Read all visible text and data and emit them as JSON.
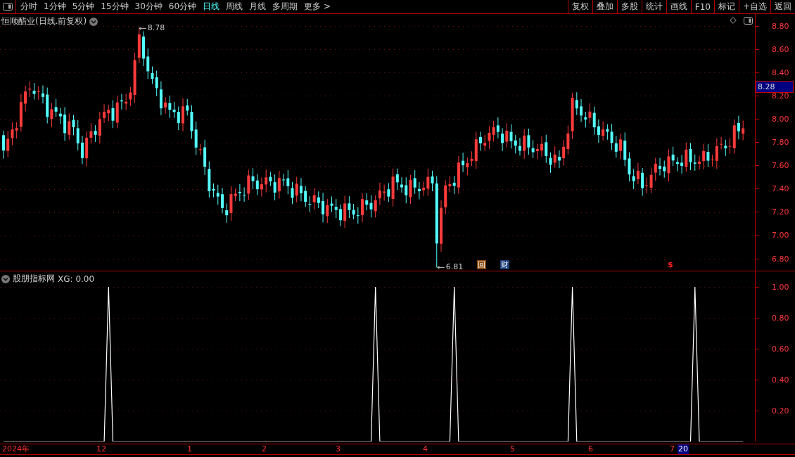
{
  "toolbar": {
    "periods": [
      {
        "label": "分时",
        "selected": false
      },
      {
        "label": "1分钟",
        "selected": false
      },
      {
        "label": "5分钟",
        "selected": false
      },
      {
        "label": "15分钟",
        "selected": false
      },
      {
        "label": "30分钟",
        "selected": false
      },
      {
        "label": "60分钟",
        "selected": false
      },
      {
        "label": "日线",
        "selected": true
      },
      {
        "label": "周线",
        "selected": false
      },
      {
        "label": "月线",
        "selected": false
      },
      {
        "label": "多周期",
        "selected": false
      },
      {
        "label": "更多 >",
        "selected": false
      }
    ],
    "actions": [
      "复权",
      "叠加",
      "多股",
      "统计",
      "画线",
      "F10",
      "标记",
      "+自选",
      "返回"
    ]
  },
  "price_panel": {
    "title": "恒顺醋业(日线.前复权)",
    "high_label": "8.78",
    "low_label": "6.81",
    "markers": [
      {
        "text": "回",
        "kind": "box"
      },
      {
        "text": "财",
        "kind": "finance"
      },
      {
        "text": "$",
        "kind": "dividend"
      }
    ],
    "axis_labels": [
      "8.80",
      "8.60",
      "8.40",
      "8.20",
      "8.00",
      "7.80",
      "7.60",
      "7.40",
      "7.20",
      "7.00",
      "6.80"
    ],
    "current_price": "8.28"
  },
  "indicator_panel": {
    "title": "股朋指标网",
    "value_label": ": 0.00",
    "chart_data": {
      "type": "line",
      "grid": true,
      "ylim": [
        0,
        1.0
      ],
      "yticks": [
        {
          "value": 0.2,
          "label": "0.20"
        },
        {
          "value": 0.4,
          "label": "0.40"
        },
        {
          "value": 0.6,
          "label": "0.60"
        },
        {
          "value": 0.8,
          "label": "0.80"
        },
        {
          "value": 1.0,
          "label": "1.00"
        }
      ],
      "series": [
        {
          "name": "XG",
          "color": "#ffffff",
          "values": [
            0,
            0,
            0,
            0,
            0,
            0,
            0,
            0,
            0,
            0,
            0,
            0,
            0,
            0,
            0,
            0,
            0,
            0,
            0,
            0,
            0,
            0,
            0,
            0,
            1,
            0,
            0,
            0,
            0,
            0,
            0,
            0,
            0,
            0,
            0,
            0,
            0,
            0,
            0,
            0,
            0,
            0,
            0,
            0,
            0,
            0,
            0,
            0,
            0,
            0,
            0,
            0,
            0,
            0,
            0,
            0,
            0,
            0,
            0,
            0,
            0,
            0,
            0,
            0,
            0,
            0,
            0,
            0,
            0,
            0,
            0,
            0,
            0,
            0,
            0,
            0,
            0,
            0,
            0,
            0,
            0,
            0,
            0,
            0,
            0,
            1,
            0,
            0,
            0,
            0,
            0,
            0,
            0,
            0,
            0,
            0,
            0,
            0,
            0,
            0,
            0,
            0,
            0,
            1,
            0,
            0,
            0,
            0,
            0,
            0,
            0,
            0,
            0,
            0,
            0,
            0,
            0,
            0,
            0,
            0,
            0,
            0,
            0,
            0,
            0,
            0,
            0,
            0,
            0,
            0,
            1,
            0,
            0,
            0,
            0,
            0,
            0,
            0,
            0,
            0,
            0,
            0,
            0,
            0,
            0,
            0,
            0,
            0,
            0,
            0,
            0,
            0,
            0,
            0,
            0,
            0,
            0,
            0,
            1,
            0,
            0,
            0,
            0,
            0,
            0,
            0,
            0,
            0,
            0,
            0
          ]
        }
      ]
    }
  },
  "date_axis": [
    {
      "label": "2024年",
      "highlighted": false
    },
    {
      "label": "12",
      "highlighted": false
    },
    {
      "label": "1",
      "highlighted": false
    },
    {
      "label": "2",
      "highlighted": false
    },
    {
      "label": "3",
      "highlighted": false
    },
    {
      "label": "4",
      "highlighted": false
    },
    {
      "label": "5",
      "highlighted": false
    },
    {
      "label": "6",
      "highlighted": false
    },
    {
      "label": "7",
      "highlighted": false
    },
    {
      "label": "20",
      "highlighted": true
    }
  ]
}
